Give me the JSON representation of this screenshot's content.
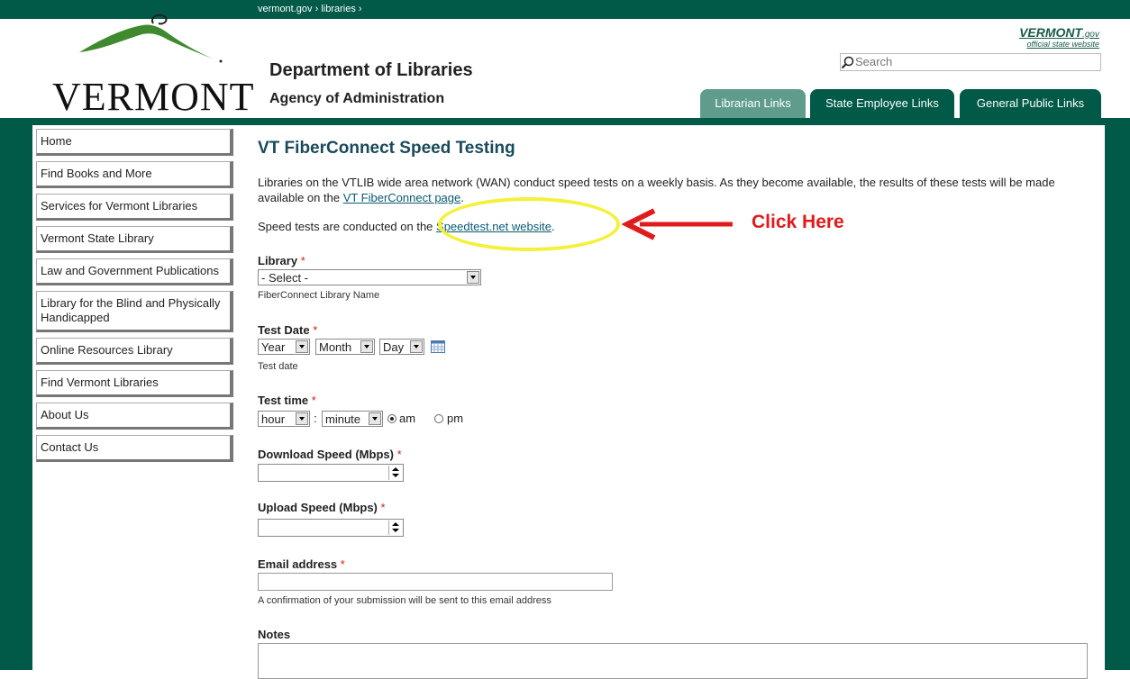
{
  "breadcrumb": {
    "site": "vermont.gov",
    "sep1": "›",
    "section": "libraries",
    "sep2": "›"
  },
  "header": {
    "logo_text": "VERMONT",
    "department": "Department of Libraries",
    "agency": "Agency of Administration",
    "vtgov_brand": "VERMONT",
    "vtgov_suffix": ".gov",
    "vtgov_tagline": "official state website",
    "search_placeholder": "Search"
  },
  "tabs": [
    {
      "label": "Librarian Links"
    },
    {
      "label": "State Employee Links"
    },
    {
      "label": "General Public Links"
    }
  ],
  "sidebar": {
    "items": [
      {
        "label": "Home"
      },
      {
        "label": "Find Books and More"
      },
      {
        "label": "Services for Vermont Libraries"
      },
      {
        "label": "Vermont State Library"
      },
      {
        "label": "Law and Government Publications"
      },
      {
        "label": "Library for the Blind and Physically Handicapped"
      },
      {
        "label": "Online Resources Library"
      },
      {
        "label": "Find Vermont Libraries"
      },
      {
        "label": "About Us"
      },
      {
        "label": "Contact Us"
      }
    ]
  },
  "main": {
    "title": "VT FiberConnect Speed Testing",
    "intro": "Libraries on the VTLIB wide area network (WAN) conduct speed tests on a weekly basis. As they become available, the results of these tests will be made available on the ",
    "intro_link": "VT FiberConnect page",
    "intro_end": ".",
    "speedtest_text": "Speed tests are conducted on the ",
    "speedtest_link": "Speedtest.net website",
    "speedtest_end": "."
  },
  "form": {
    "required_mark": "*",
    "library": {
      "label": "Library",
      "selected": "- Select -",
      "help": "FiberConnect Library Name"
    },
    "test_date": {
      "label": "Test Date",
      "year": "Year",
      "month": "Month",
      "day": "Day",
      "help": "Test date"
    },
    "test_time": {
      "label": "Test time",
      "hour": "hour",
      "colon": ":",
      "minute": "minute",
      "am": "am",
      "pm": "pm",
      "selected": "am"
    },
    "download": {
      "label": "Download Speed (Mbps)",
      "value": ""
    },
    "upload": {
      "label": "Upload Speed (Mbps)",
      "value": ""
    },
    "email": {
      "label": "Email address",
      "value": "",
      "help": "A confirmation of your submission will be sent to this email address"
    },
    "notes": {
      "label": "Notes",
      "value": ""
    }
  },
  "annotation": {
    "text": "Click Here"
  },
  "colors": {
    "brand_green": "#005a47",
    "tab_inactive": "#5f9c8c",
    "annotation_red": "#e01b1b",
    "highlight_yellow": "#f5f03a"
  }
}
